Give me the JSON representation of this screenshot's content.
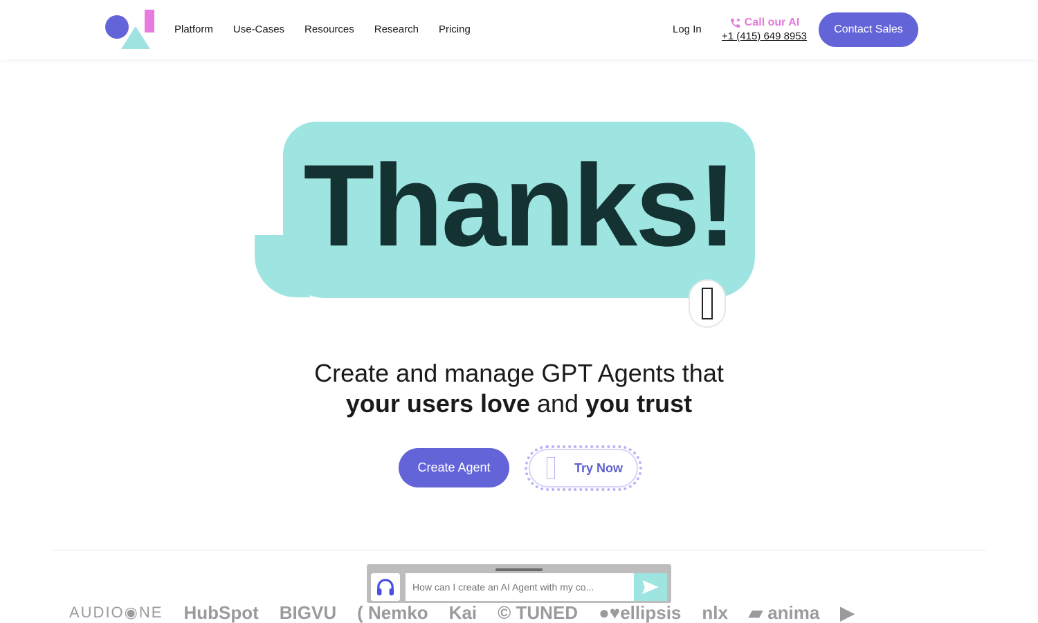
{
  "nav": {
    "items": [
      "Platform",
      "Use-Cases",
      "Resources",
      "Research",
      "Pricing"
    ],
    "login": "Log In",
    "call_label": "Call our AI",
    "phone": "+1 (415) 649 8953",
    "contact": "Contact Sales"
  },
  "hero": {
    "title": "Thanks!",
    "line1": "Create and manage GPT Agents that",
    "b1": "your users love",
    "mid": " and ",
    "b2": "you trust"
  },
  "cta": {
    "create": "Create Agent",
    "try": "Try Now"
  },
  "logos": [
    "AUDIO◉NE",
    "HubSpot",
    "BIGVU",
    "( Nemko",
    "Kai",
    "© TUNED",
    "●♥ellipsis",
    "nlx",
    "▰ anima",
    "▶"
  ],
  "chat": {
    "placeholder": "How can I create an AI Agent with my co..."
  },
  "colors": {
    "accent": "#6364d8",
    "pink": "#e07ad8",
    "teal": "#9ee5e2",
    "dark": "#143231"
  }
}
